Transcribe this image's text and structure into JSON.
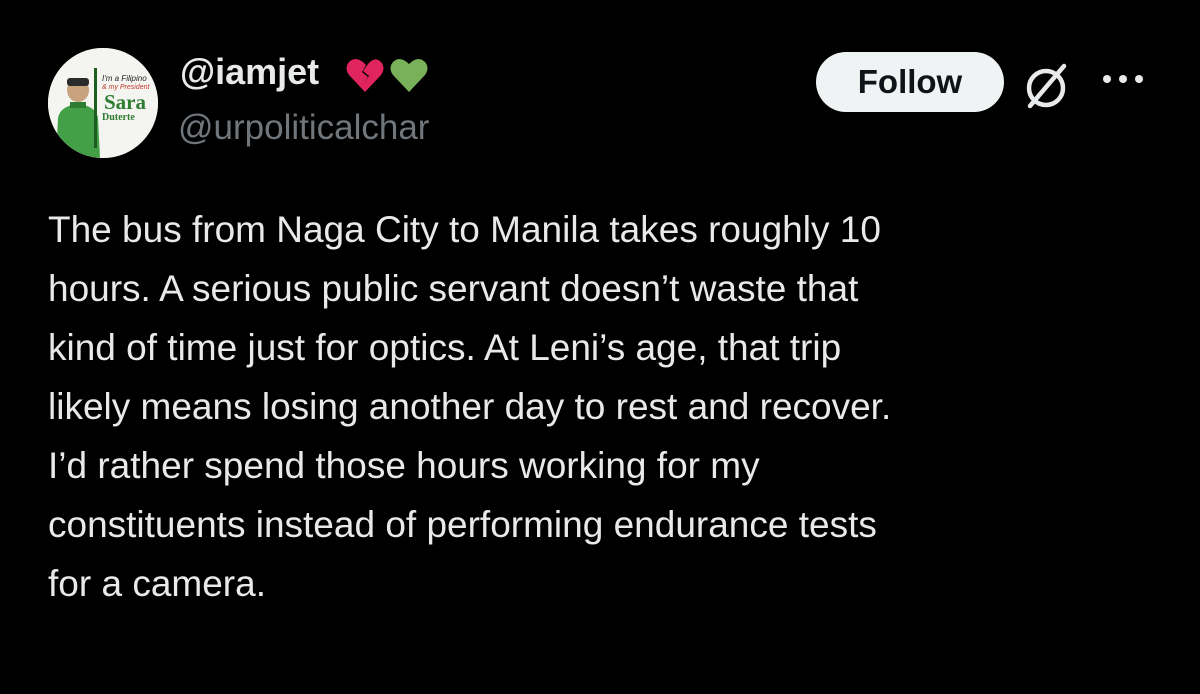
{
  "author": {
    "display_name": "@iamjet",
    "badges": [
      "broken-heart-emoji",
      "green-heart-emoji"
    ],
    "handle": "@urpoliticalchar",
    "avatar": {
      "line1": "I'm a Filipino",
      "line2": "& my President",
      "line3": "Sara",
      "line4": "Duterte"
    }
  },
  "actions": {
    "follow_label": "Follow",
    "grok_icon": "grok-icon",
    "more_icon": "more-icon"
  },
  "tweet": {
    "lines": [
      "The bus from Naga City to Manila takes roughly 10",
      "hours. A serious public servant doesn’t waste that",
      "kind of time just for optics. At Leni’s age, that trip",
      "likely means losing another day to rest and recover.",
      "I’d rather spend those hours working for my",
      "constituents instead of performing endurance tests",
      "for a camera."
    ]
  },
  "colors": {
    "background": "#000000",
    "text_primary": "#e7e9ea",
    "text_secondary": "#71767b",
    "button_bg": "#eff3f4",
    "button_text": "#0f1419",
    "broken_heart": "#e0245e",
    "green_heart": "#78b159"
  }
}
